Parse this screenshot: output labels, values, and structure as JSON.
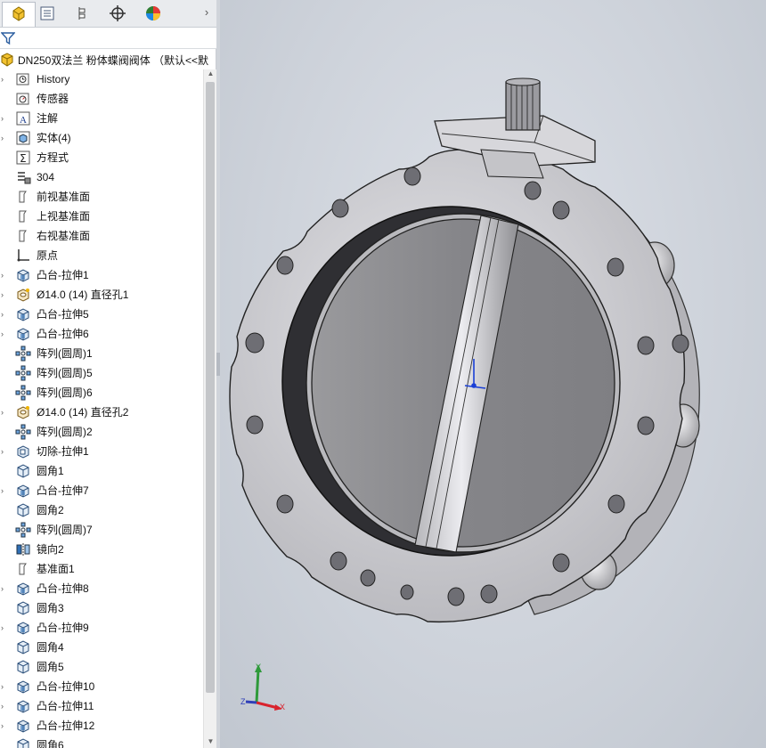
{
  "panel": {
    "tabs": [
      {
        "name": "feature-manager",
        "icon": "assembly-tree-icon"
      },
      {
        "name": "property-manager",
        "icon": "property-list-icon"
      },
      {
        "name": "configuration-manager",
        "icon": "configuration-icon"
      },
      {
        "name": "dimxpert-manager",
        "icon": "crosshair-icon"
      },
      {
        "name": "display-manager",
        "icon": "color-wheel-icon"
      }
    ],
    "more_label": "›",
    "root_label": "DN250双法兰 粉体蝶阀阀体 （默认<<默"
  },
  "tree": [
    {
      "label": "History",
      "icon": "history-icon",
      "expandable": true
    },
    {
      "label": "传感器",
      "icon": "sensor-icon",
      "expandable": false
    },
    {
      "label": "注解",
      "icon": "annotation-icon",
      "expandable": true
    },
    {
      "label": "实体(4)",
      "icon": "solid-bodies-icon",
      "expandable": true
    },
    {
      "label": "方程式",
      "icon": "equations-icon",
      "expandable": false
    },
    {
      "label": "304",
      "icon": "material-icon",
      "expandable": false
    },
    {
      "label": "前视基准面",
      "icon": "plane-icon",
      "expandable": false
    },
    {
      "label": "上视基准面",
      "icon": "plane-icon",
      "expandable": false
    },
    {
      "label": "右视基准面",
      "icon": "plane-icon",
      "expandable": false
    },
    {
      "label": "原点",
      "icon": "origin-icon",
      "expandable": false
    },
    {
      "label": "凸台-拉伸1",
      "icon": "boss-extrude-icon",
      "expandable": true
    },
    {
      "label": "Ø14.0 (14) 直径孔1",
      "icon": "hole-wizard-icon",
      "expandable": true
    },
    {
      "label": "凸台-拉伸5",
      "icon": "boss-extrude-icon",
      "expandable": true
    },
    {
      "label": "凸台-拉伸6",
      "icon": "boss-extrude-icon",
      "expandable": true
    },
    {
      "label": "阵列(圆周)1",
      "icon": "circular-pattern-icon",
      "expandable": false
    },
    {
      "label": "阵列(圆周)5",
      "icon": "circular-pattern-icon",
      "expandable": false
    },
    {
      "label": "阵列(圆周)6",
      "icon": "circular-pattern-icon",
      "expandable": false
    },
    {
      "label": "Ø14.0 (14) 直径孔2",
      "icon": "hole-wizard-icon",
      "expandable": true
    },
    {
      "label": "阵列(圆周)2",
      "icon": "circular-pattern-icon",
      "expandable": false
    },
    {
      "label": "切除-拉伸1",
      "icon": "cut-extrude-icon",
      "expandable": true
    },
    {
      "label": "圆角1",
      "icon": "fillet-icon",
      "expandable": false
    },
    {
      "label": "凸台-拉伸7",
      "icon": "boss-extrude-icon",
      "expandable": true
    },
    {
      "label": "圆角2",
      "icon": "fillet-icon",
      "expandable": false
    },
    {
      "label": "阵列(圆周)7",
      "icon": "circular-pattern-icon",
      "expandable": false
    },
    {
      "label": "镜向2",
      "icon": "mirror-icon",
      "expandable": false
    },
    {
      "label": "基准面1",
      "icon": "plane-icon",
      "expandable": false
    },
    {
      "label": "凸台-拉伸8",
      "icon": "boss-extrude-icon",
      "expandable": true
    },
    {
      "label": "圆角3",
      "icon": "fillet-icon",
      "expandable": false
    },
    {
      "label": "凸台-拉伸9",
      "icon": "boss-extrude-icon",
      "expandable": true
    },
    {
      "label": "圆角4",
      "icon": "fillet-icon",
      "expandable": false
    },
    {
      "label": "圆角5",
      "icon": "fillet-icon",
      "expandable": false
    },
    {
      "label": "凸台-拉伸10",
      "icon": "boss-extrude-icon",
      "expandable": true
    },
    {
      "label": "凸台-拉伸11",
      "icon": "boss-extrude-icon",
      "expandable": true
    },
    {
      "label": "凸台-拉伸12",
      "icon": "boss-extrude-icon",
      "expandable": true
    },
    {
      "label": "圆角6",
      "icon": "fillet-icon",
      "expandable": false
    }
  ],
  "triad": {
    "x_label": "X",
    "y_label": "Y",
    "z_label": "Z",
    "x_color": "#d9232d",
    "y_color": "#2e9a3a",
    "z_color": "#2f3fb8"
  },
  "colors": {
    "accent": "#f0b400",
    "viewport_bg": "#cdd2da",
    "metal": "#c9c9cd",
    "disc": "#8d8d90"
  }
}
